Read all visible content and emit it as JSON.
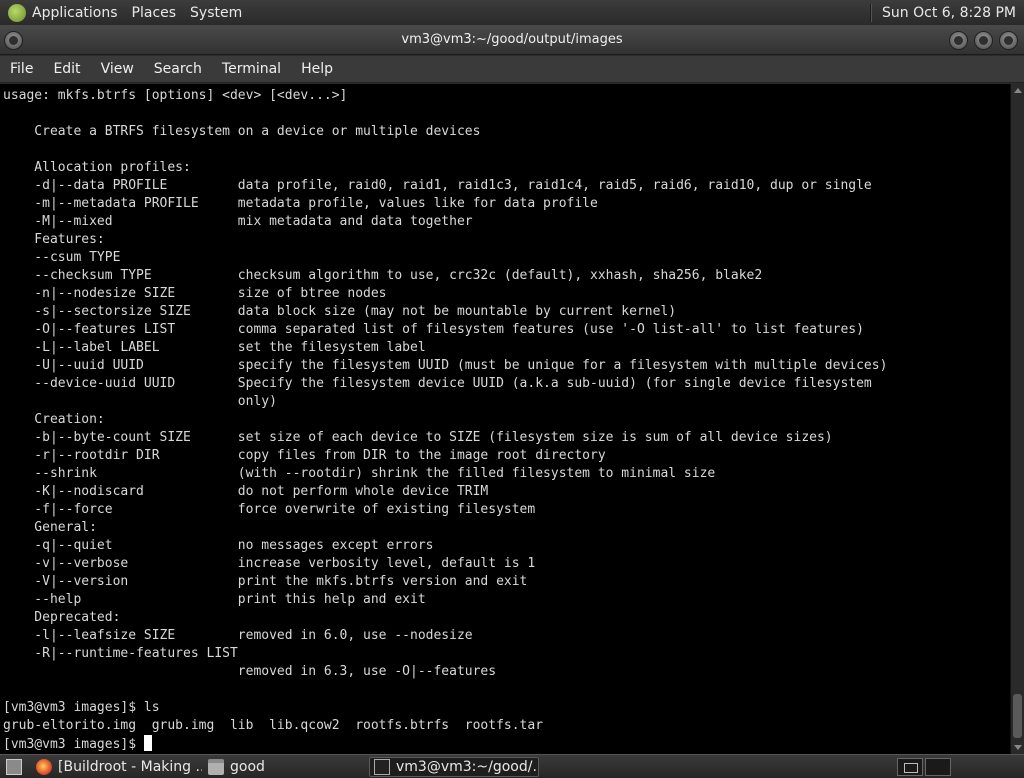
{
  "top_panel": {
    "menus": [
      "Applications",
      "Places",
      "System"
    ],
    "clock": "Sun Oct  6,  8:28 PM"
  },
  "window": {
    "title": "vm3@vm3:~/good/output/images"
  },
  "menubar": [
    "File",
    "Edit",
    "View",
    "Search",
    "Terminal",
    "Help"
  ],
  "terminal": {
    "lines": [
      "usage: mkfs.btrfs [options] <dev> [<dev...>]",
      "",
      "    Create a BTRFS filesystem on a device or multiple devices",
      "",
      "    Allocation profiles:",
      "    -d|--data PROFILE         data profile, raid0, raid1, raid1c3, raid1c4, raid5, raid6, raid10, dup or single",
      "    -m|--metadata PROFILE     metadata profile, values like for data profile",
      "    -M|--mixed                mix metadata and data together",
      "    Features:",
      "    --csum TYPE",
      "    --checksum TYPE           checksum algorithm to use, crc32c (default), xxhash, sha256, blake2",
      "    -n|--nodesize SIZE        size of btree nodes",
      "    -s|--sectorsize SIZE      data block size (may not be mountable by current kernel)",
      "    -O|--features LIST        comma separated list of filesystem features (use '-O list-all' to list features)",
      "    -L|--label LABEL          set the filesystem label",
      "    -U|--uuid UUID            specify the filesystem UUID (must be unique for a filesystem with multiple devices)",
      "    --device-uuid UUID        Specify the filesystem device UUID (a.k.a sub-uuid) (for single device filesystem",
      "                              only)",
      "    Creation:",
      "    -b|--byte-count SIZE      set size of each device to SIZE (filesystem size is sum of all device sizes)",
      "    -r|--rootdir DIR          copy files from DIR to the image root directory",
      "    --shrink                  (with --rootdir) shrink the filled filesystem to minimal size",
      "    -K|--nodiscard            do not perform whole device TRIM",
      "    -f|--force                force overwrite of existing filesystem",
      "    General:",
      "    -q|--quiet                no messages except errors",
      "    -v|--verbose              increase verbosity level, default is 1",
      "    -V|--version              print the mkfs.btrfs version and exit",
      "    --help                    print this help and exit",
      "    Deprecated:",
      "    -l|--leafsize SIZE        removed in 6.0, use --nodesize",
      "    -R|--runtime-features LIST",
      "                              removed in 6.3, use -O|--features",
      "",
      "[vm3@vm3 images]$ ls",
      "grub-eltorito.img  grub.img  lib  lib.qcow2  rootfs.btrfs  rootfs.tar"
    ],
    "prompt": "[vm3@vm3 images]$ "
  },
  "taskbar": {
    "tasks": [
      "[Buildroot - Making ...",
      "good",
      "vm3@vm3:~/good/..."
    ]
  },
  "icons": {
    "panel_logo": "gnome-foot-icon",
    "desktop": "show-desktop-icon",
    "firefox": "firefox-icon",
    "folder": "folder-icon",
    "terminal": "terminal-icon"
  }
}
